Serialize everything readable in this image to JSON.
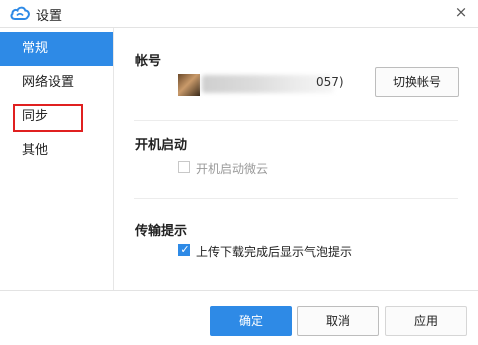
{
  "window": {
    "title": "设置",
    "close_glyph": "×",
    "logo_icon": "weiyun-cloud-logo",
    "accent_color": "#2e8ae6"
  },
  "sidebar": {
    "items": [
      {
        "label": "常规",
        "active": true
      },
      {
        "label": "网络设置",
        "active": false
      },
      {
        "label": "同步",
        "active": false,
        "highlighted": true
      },
      {
        "label": "其他",
        "active": false
      }
    ]
  },
  "account": {
    "section_title": "帐号",
    "id_tail": "057)",
    "switch_button": "切换帐号"
  },
  "startup": {
    "section_title": "开机启动",
    "checkbox_label": "开机启动微云",
    "checked": false,
    "disabled": true
  },
  "transfer": {
    "section_title": "传输提示",
    "checkbox_label": "上传下载完成后显示气泡提示",
    "checked": true
  },
  "footer": {
    "ok": "确定",
    "cancel": "取消",
    "apply": "应用"
  }
}
